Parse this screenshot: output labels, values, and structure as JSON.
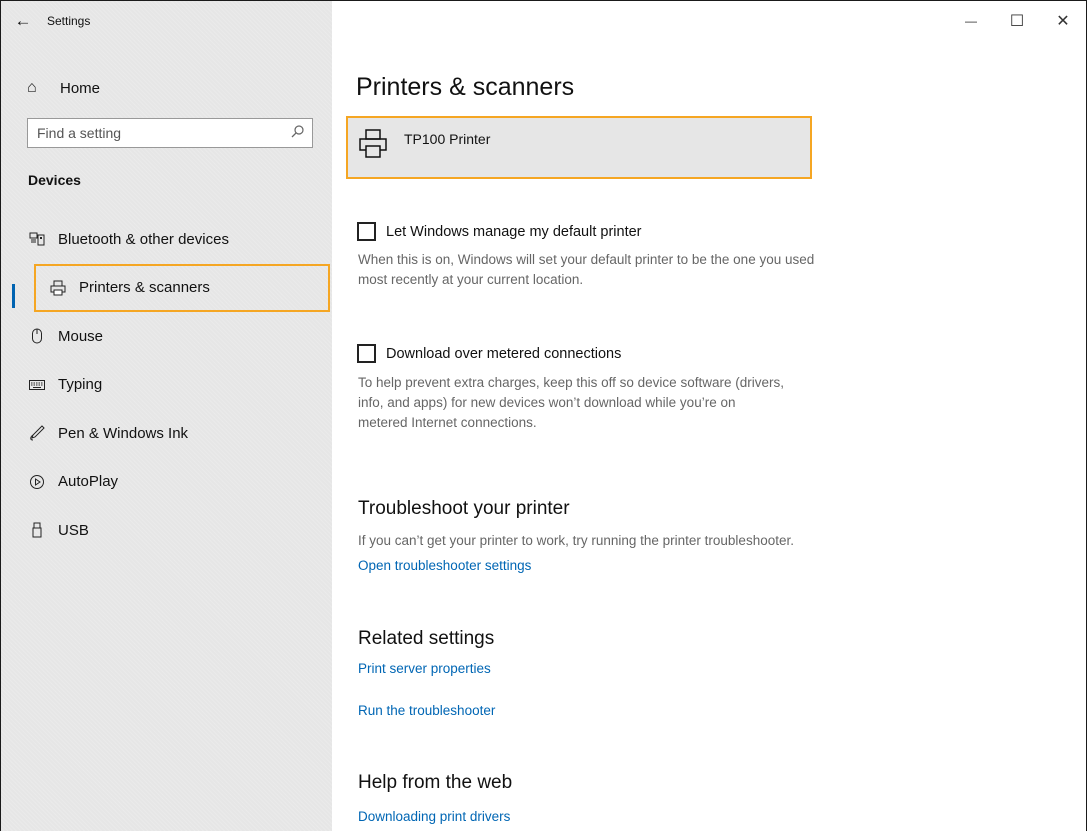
{
  "window": {
    "title": "Settings",
    "back_icon": "←",
    "controls": {
      "minimize": "—",
      "maximize": "☐",
      "close": "✕"
    }
  },
  "sidebar": {
    "home": {
      "label": "Home",
      "icon": "⌂"
    },
    "search": {
      "placeholder": "Find a setting",
      "value": ""
    },
    "section": "Devices",
    "items": [
      {
        "label": "Bluetooth & other devices",
        "icon": "bluetooth-devices-icon"
      },
      {
        "label": "Printers & scanners",
        "icon": "printer-icon",
        "selected": true
      },
      {
        "label": "Mouse",
        "icon": "mouse-icon"
      },
      {
        "label": "Typing",
        "icon": "keyboard-icon"
      },
      {
        "label": "Pen & Windows Ink",
        "icon": "pen-icon"
      },
      {
        "label": "AutoPlay",
        "icon": "autoplay-icon"
      },
      {
        "label": "USB",
        "icon": "usb-icon"
      }
    ]
  },
  "main": {
    "title": "Printers & scanners",
    "printer": {
      "name": "TP100 Printer"
    },
    "default_printer": {
      "label": "Let Windows manage my default printer",
      "checked": false,
      "description": "When this is on, Windows will set your default printer to be the one you used most recently at your current location."
    },
    "metered": {
      "label": "Download over metered connections",
      "checked": false,
      "description": "To help prevent extra charges, keep this off so device software (drivers, info, and apps) for new devices won’t download while you’re on metered Internet connections."
    },
    "troubleshoot": {
      "heading": "Troubleshoot your printer",
      "text": "If you can’t get your printer to work, try running the printer troubleshooter.",
      "link": "Open troubleshooter settings"
    },
    "related": {
      "heading": "Related settings",
      "links": [
        "Print server properties",
        "Run the troubleshooter"
      ]
    },
    "help": {
      "heading": "Help from the web",
      "links": [
        "Downloading print drivers"
      ]
    }
  },
  "colors": {
    "highlight": "#f5a623",
    "accent": "#0063b1",
    "link": "#0066b4",
    "sidebar_bg": "#e6e6e6"
  }
}
